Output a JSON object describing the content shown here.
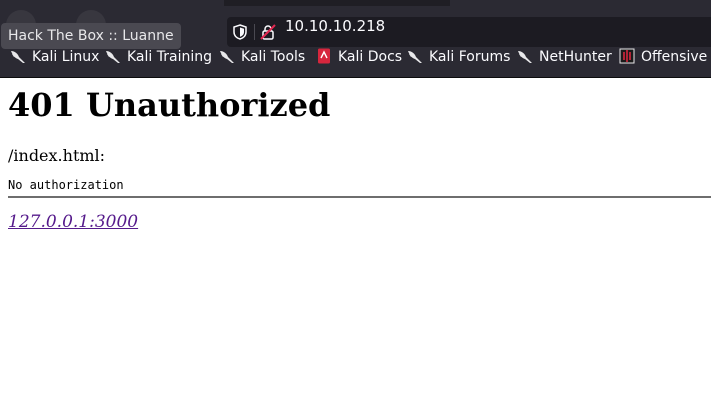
{
  "tab": {
    "tooltip": "Hack The Box :: Luanne"
  },
  "urlbar": {
    "url": "10.10.10.218"
  },
  "bookmarks": [
    {
      "label": "Kali Linux",
      "icon": "kali-dragon-icon"
    },
    {
      "label": "Kali Training",
      "icon": "kali-dragon-icon"
    },
    {
      "label": "Kali Tools",
      "icon": "kali-dragon-icon"
    },
    {
      "label": "Kali Docs",
      "icon": "kali-docs-icon"
    },
    {
      "label": "Kali Forums",
      "icon": "kali-dragon-icon"
    },
    {
      "label": "NetHunter",
      "icon": "kali-dragon-icon"
    },
    {
      "label": "Offensive S",
      "icon": "offsec-icon"
    }
  ],
  "page": {
    "heading": "401 Unauthorized",
    "path": "/index.html:",
    "message": "No authorization",
    "address": "127.0.0.1:3000"
  },
  "colors": {
    "chrome": "#2b2a33",
    "urlbar": "#1c1b22",
    "visited_link": "#551a8b"
  }
}
